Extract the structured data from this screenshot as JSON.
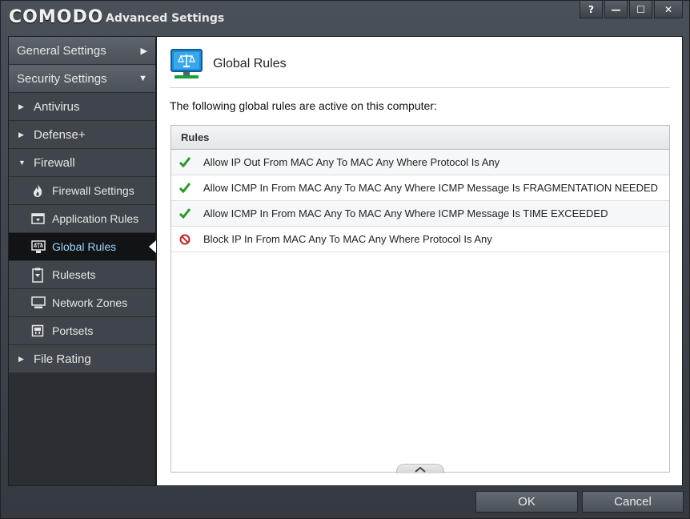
{
  "window": {
    "brand": "COMODO",
    "title": "Advanced Settings",
    "buttons": {
      "help": "?",
      "minimize": "—",
      "maximize": "☐",
      "close": "✕"
    }
  },
  "sidebar": {
    "general_settings": "General Settings",
    "security_settings": "Security Settings",
    "categories": {
      "antivirus": "Antivirus",
      "defense": "Defense+",
      "firewall": "Firewall",
      "file_rating": "File Rating"
    },
    "firewall_items": [
      {
        "label": "Firewall Settings",
        "icon": "flame-icon"
      },
      {
        "label": "Application Rules",
        "icon": "application-rules-icon"
      },
      {
        "label": "Global Rules",
        "icon": "global-rules-icon",
        "active": true
      },
      {
        "label": "Rulesets",
        "icon": "rulesets-icon"
      },
      {
        "label": "Network Zones",
        "icon": "monitor-icon"
      },
      {
        "label": "Portsets",
        "icon": "portsets-icon"
      }
    ]
  },
  "main": {
    "title": "Global Rules",
    "description": "The following global rules are active on this computer:",
    "rules_header": "Rules",
    "rules": [
      {
        "status": "allow",
        "text": "Allow IP Out From MAC Any To MAC Any Where Protocol Is Any"
      },
      {
        "status": "allow",
        "text": "Allow ICMP In From MAC Any To MAC Any Where ICMP Message Is FRAGMENTATION NEEDED"
      },
      {
        "status": "allow",
        "text": "Allow ICMP In From MAC Any To MAC Any Where ICMP Message Is TIME EXCEEDED"
      },
      {
        "status": "block",
        "text": "Block IP In From MAC Any To MAC Any Where Protocol Is Any"
      }
    ]
  },
  "footer": {
    "ok": "OK",
    "cancel": "Cancel"
  },
  "colors": {
    "allow": "#2a9a2a",
    "block": "#c0282a",
    "active_text": "#9fd3ff",
    "accent": "#1e8fd6"
  }
}
